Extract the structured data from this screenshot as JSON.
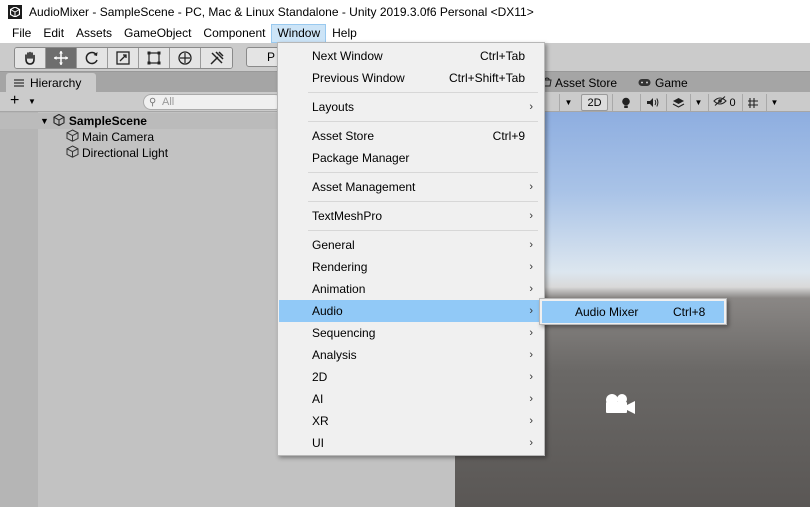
{
  "window": {
    "title": "AudioMixer - SampleScene - PC, Mac & Linux Standalone - Unity 2019.3.0f6 Personal <DX11>",
    "icon": "unity-logo-icon"
  },
  "menubar": {
    "items": [
      "File",
      "Edit",
      "Assets",
      "GameObject",
      "Component",
      "Window",
      "Help"
    ],
    "active": "Window"
  },
  "toolbar": {
    "tools": [
      "hand-tool-icon",
      "move-tool-icon",
      "rotate-tool-icon",
      "scale-tool-icon",
      "rect-tool-icon",
      "transform-tool-icon",
      "custom-tool-icon"
    ],
    "selected_tool": "move-tool-icon",
    "pivot_label": "P"
  },
  "hierarchy": {
    "tab_label": "Hierarchy",
    "add_label": "+",
    "search_placeholder": "All",
    "scene_name": "SampleScene",
    "objects": [
      "Main Camera",
      "Directional Light"
    ]
  },
  "scene": {
    "tabs": [
      "Asset Store",
      "Game"
    ],
    "mode_2d": "2D",
    "hidden_count": "0"
  },
  "window_menu": {
    "items": [
      {
        "label": "Next Window",
        "shortcut": "Ctrl+Tab"
      },
      {
        "label": "Previous Window",
        "shortcut": "Ctrl+Shift+Tab"
      },
      {
        "label": "Layouts",
        "arrow": "›"
      },
      {
        "label": "Asset Store",
        "shortcut": "Ctrl+9"
      },
      {
        "label": "Package Manager"
      },
      {
        "label": "Asset Management",
        "arrow": "›"
      },
      {
        "label": "TextMeshPro",
        "arrow": "›"
      },
      {
        "label": "General",
        "arrow": "›"
      },
      {
        "label": "Rendering",
        "arrow": "›"
      },
      {
        "label": "Animation",
        "arrow": "›"
      },
      {
        "label": "Audio",
        "arrow": "›"
      },
      {
        "label": "Sequencing",
        "arrow": "›"
      },
      {
        "label": "Analysis",
        "arrow": "›"
      },
      {
        "label": "2D",
        "arrow": "›"
      },
      {
        "label": "AI",
        "arrow": "›"
      },
      {
        "label": "XR",
        "arrow": "›"
      },
      {
        "label": "UI",
        "arrow": "›"
      }
    ],
    "highlighted": "Audio"
  },
  "audio_submenu": {
    "items": [
      {
        "label": "Audio Mixer",
        "shortcut": "Ctrl+8"
      }
    ]
  },
  "colors": {
    "menu_highlight": "#91c9f7",
    "menubar_active": "#cce4f7",
    "panel_bg": "#c2c2c2",
    "sky": "#8eaee0"
  }
}
